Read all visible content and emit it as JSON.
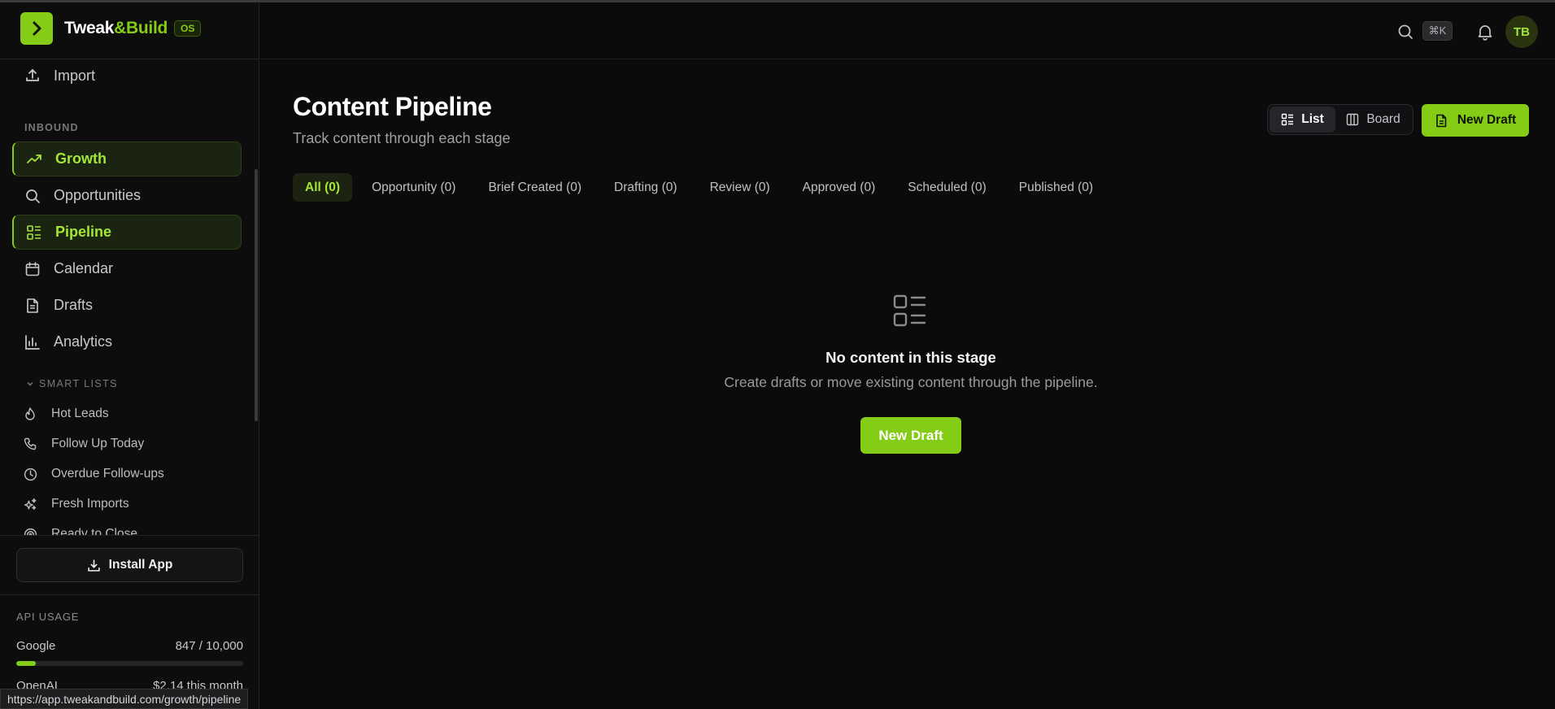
{
  "brand": {
    "name_part1": "Tweak",
    "name_part2": "&Build",
    "badge": "OS",
    "logo_icon": "chevron-right-icon"
  },
  "sidebar": {
    "import_label": "Import",
    "inbound_label": "INBOUND",
    "items": [
      {
        "label": "Growth",
        "icon": "trending-up-icon",
        "active": true
      },
      {
        "label": "Opportunities",
        "icon": "search-icon",
        "active": false
      },
      {
        "label": "Pipeline",
        "icon": "list-icon",
        "active": true
      },
      {
        "label": "Calendar",
        "icon": "calendar-icon",
        "active": false
      },
      {
        "label": "Drafts",
        "icon": "file-icon",
        "active": false
      },
      {
        "label": "Analytics",
        "icon": "bar-chart-icon",
        "active": false
      }
    ],
    "smart_lists_label": "SMART LISTS",
    "smart_lists": [
      {
        "label": "Hot Leads",
        "icon": "flame-icon"
      },
      {
        "label": "Follow Up Today",
        "icon": "phone-icon"
      },
      {
        "label": "Overdue Follow-ups",
        "icon": "clock-icon"
      },
      {
        "label": "Fresh Imports",
        "icon": "sparkles-icon"
      },
      {
        "label": "Ready to Close",
        "icon": "target-icon"
      }
    ],
    "install_label": "Install App",
    "api": {
      "label": "API USAGE",
      "google_label": "Google",
      "google_value": "847 / 10,000",
      "google_fraction": 0.0847,
      "openai_label": "OpenAI",
      "openai_value": "$2.14 this month"
    }
  },
  "status_url": "https://app.tweakandbuild.com/growth/pipeline",
  "topbar": {
    "shortcut": "⌘K",
    "avatar": "TB"
  },
  "main": {
    "title": "Content Pipeline",
    "subtitle": "Track content through each stage",
    "view_list": "List",
    "view_board": "Board",
    "new_draft": "New Draft",
    "tabs": [
      {
        "label": "All (0)",
        "active": true
      },
      {
        "label": "Opportunity (0)"
      },
      {
        "label": "Brief Created (0)"
      },
      {
        "label": "Drafting (0)"
      },
      {
        "label": "Review (0)"
      },
      {
        "label": "Approved (0)"
      },
      {
        "label": "Scheduled (0)"
      },
      {
        "label": "Published (0)"
      }
    ],
    "empty": {
      "title": "No content in this stage",
      "subtitle": "Create drafts or move existing content through the pipeline.",
      "button": "New Draft"
    }
  },
  "colors": {
    "accent": "#84cc16",
    "background": "#0b0b0c",
    "active_bg": "#1b2410"
  }
}
